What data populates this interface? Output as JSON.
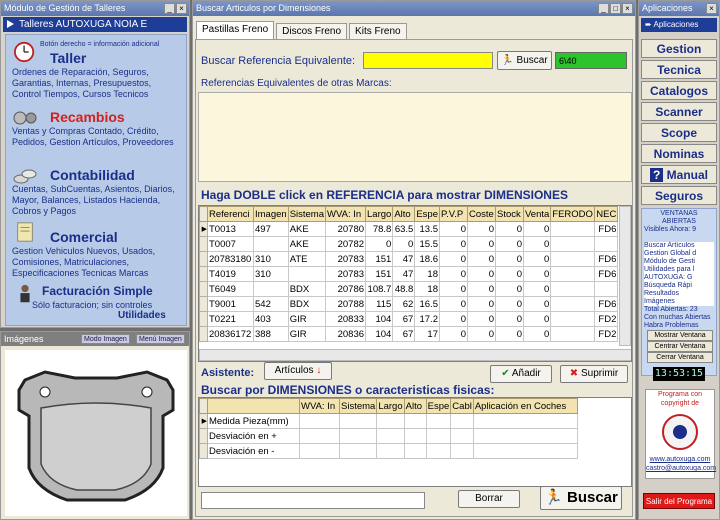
{
  "left": {
    "title": "Módulo de Gestión de Talleres",
    "header": "Talleres AUTOXUGA NOIA E",
    "hint": "Botón derecho = información adicional",
    "sections": [
      {
        "title": "Taller",
        "text": "Ordenes de Reparación, Seguros, Garantias, Internas, Presupuestos, Control Tiempos, Cursos Tecnicos"
      },
      {
        "title": "Recambios",
        "text": "Ventas y Compras Contado, Crédito, Pedidos, Gestion Artículos, Proveedores"
      },
      {
        "title": "Contabilidad",
        "text": "Cuentas, SubCuentas, Asientos, Diarios, Mayor, Balances, Listados Hacienda, Cobros y Pagos"
      },
      {
        "title": "Comercial",
        "text": "Gestion Vehiculos Nuevos, Usados, Comisiones, Matriculaciones, Especificaciones Tecnicas Marcas"
      },
      {
        "title": "Facturación Simple",
        "text": "Sólo facturacion; sin controles"
      }
    ],
    "utilidades": "Utilidades",
    "images_title": "Imágenes",
    "modo_imagen": "Modo Imagen",
    "menu_imagen": "Menú Imagen"
  },
  "center": {
    "title": "Buscar Articulos por Dimensiones",
    "tabs": [
      "Pastillas Freno",
      "Discos Freno",
      "Kits Freno"
    ],
    "buscar_label": "Buscar Referencia Equivalente:",
    "buscar_value": "",
    "buscar_btn": "Buscar",
    "count_value": "6\\40",
    "refs_label": "Referencias Equivalentes de otras Marcas:",
    "dbl_label": "Haga DOBLE click en REFERENCIA para mostrar DIMENSIONES",
    "columns": [
      "Referenci",
      "Imagen",
      "Sistema",
      "WVA: In",
      "Largo",
      "Alto",
      "Espe",
      "P.V.P",
      "Coste",
      "Stock",
      "Venta",
      "FERODO",
      "NEC"
    ],
    "rows": [
      [
        "T0013",
        "497",
        "AKE",
        "20780",
        "78.8",
        "63.5",
        "13.5",
        "0",
        "0",
        "0",
        "0",
        "",
        "FD6"
      ],
      [
        "T0007",
        "",
        "AKE",
        "20782",
        "0",
        "0",
        "15.5",
        "0",
        "0",
        "0",
        "0",
        "",
        ""
      ],
      [
        "20783180",
        "310",
        "ATE",
        "20783",
        "151",
        "47",
        "18.6",
        "0",
        "0",
        "0",
        "0",
        "",
        "FD6"
      ],
      [
        "T4019",
        "310",
        "",
        "20783",
        "151",
        "47",
        "18",
        "0",
        "0",
        "0",
        "0",
        "",
        "FD6"
      ],
      [
        "T6049",
        "",
        "BDX",
        "20786",
        "108.7",
        "48.8",
        "18",
        "0",
        "0",
        "0",
        "0",
        "",
        ""
      ],
      [
        "T9001",
        "542",
        "BDX",
        "20788",
        "115",
        "62",
        "16.5",
        "0",
        "0",
        "0",
        "0",
        "",
        "FD6"
      ],
      [
        "T0221",
        "403",
        "GIR",
        "20833",
        "104",
        "67",
        "17.2",
        "0",
        "0",
        "0",
        "0",
        "",
        "FD2"
      ],
      [
        "20836172",
        "388",
        "GIR",
        "20836",
        "104",
        "67",
        "17",
        "0",
        "0",
        "0",
        "0",
        "",
        "FD2"
      ]
    ],
    "asistente_label": "Asistente:",
    "articulos_btn": "Artículos",
    "anadir_btn": "Añadir",
    "suprimir_btn": "Suprimir",
    "dims_label": "Buscar por DIMENSIONES o caracteristicas fisicas:",
    "dims_columns": [
      "WVA: In",
      "Sistema",
      "Largo",
      "Alto",
      "Espe",
      "Cabl",
      "Aplicación en Coches"
    ],
    "dims_rows": [
      "Medida Pieza(mm)",
      "Desviación en +",
      "Desviación en -"
    ],
    "bottom_input": "",
    "borrar_btn": "Borrar",
    "buscar_big_btn": "Buscar"
  },
  "right": {
    "title": "Aplicaciones",
    "header": "Aplicaciones",
    "buttons": [
      "Gestion",
      "Tecnica",
      "Catalogos",
      "Scanner",
      "Scope",
      "Nominas",
      "Manual",
      "Seguros"
    ],
    "ventanas_title": "VENTANAS ABIERTAS",
    "visibles": "Visibles Ahora: 9",
    "items": [
      "Buscar Artículos",
      "Gestion Global d",
      "Módulo de Gesti",
      "Utilidades para l",
      "AUTOXUGA: G",
      "Búsqueda Rápi",
      "Resultados",
      "Imágenes"
    ],
    "total": "Total Abiertas: 23",
    "muchas": "Con muchas Abiertas Habra Problemas",
    "mostrar": "Mostrar Ventana",
    "centrar": "Centrar Ventana",
    "cerrar": "Cerrar Ventana",
    "clock": "13:53:15",
    "copyright1": "Programa con",
    "copyright2": "copyright de",
    "web": "www.autoxuga.com",
    "email": "castro@autoxuga.com",
    "salir": "Salir del Programa"
  }
}
